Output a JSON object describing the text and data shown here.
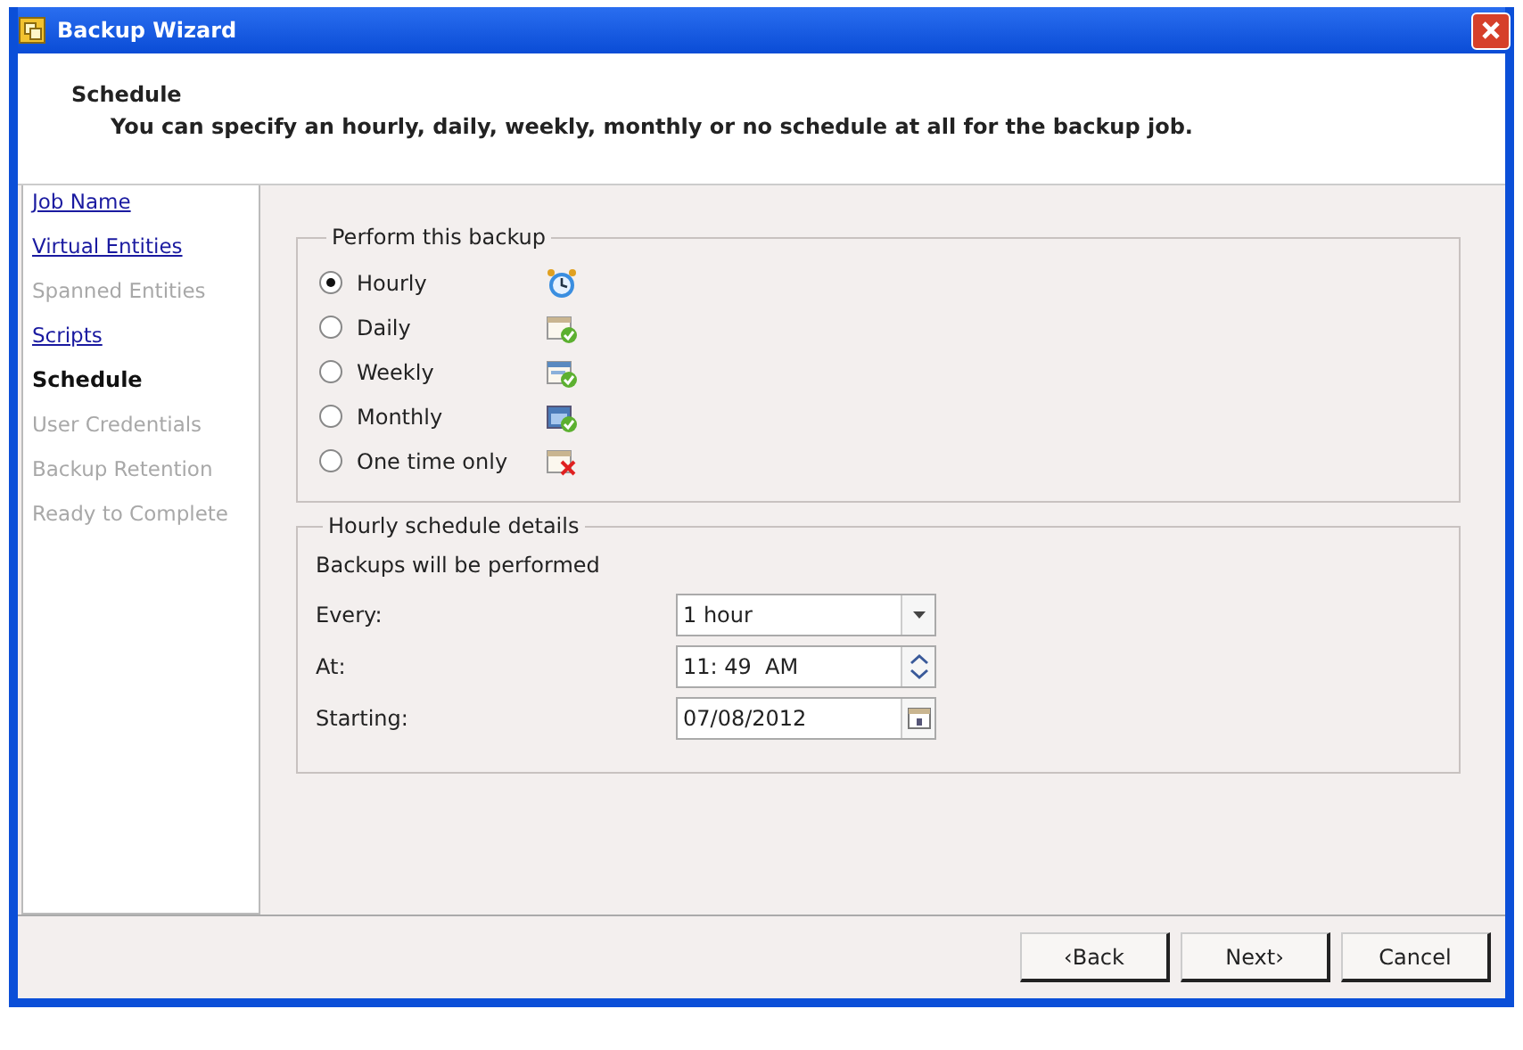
{
  "window": {
    "title": "Backup Wizard"
  },
  "header": {
    "title": "Schedule",
    "description": "You can specify an hourly, daily, weekly, monthly or no schedule at all for the backup job."
  },
  "steps": [
    {
      "label": "Job Name",
      "kind": "link"
    },
    {
      "label": "Virtual Entities",
      "kind": "link"
    },
    {
      "label": "Spanned Entities",
      "kind": "disabled"
    },
    {
      "label": "Scripts",
      "kind": "link"
    },
    {
      "label": "Schedule",
      "kind": "current"
    },
    {
      "label": "User Credentials",
      "kind": "disabled"
    },
    {
      "label": "Backup Retention",
      "kind": "disabled"
    },
    {
      "label": "Ready to Complete",
      "kind": "disabled"
    }
  ],
  "frequency": {
    "legend": "Perform this backup",
    "options": [
      {
        "label": "Hourly",
        "selected": true
      },
      {
        "label": "Daily",
        "selected": false
      },
      {
        "label": "Weekly",
        "selected": false
      },
      {
        "label": "Monthly",
        "selected": false
      },
      {
        "label": "One time only",
        "selected": false
      }
    ]
  },
  "details": {
    "legend": "Hourly schedule details",
    "intro": "Backups will be performed",
    "fields": [
      {
        "label": "Every:",
        "value": "1 hour",
        "kind": "dropdown"
      },
      {
        "label": "At:",
        "value": "11: 49  AM",
        "kind": "spinner"
      },
      {
        "label": "Starting:",
        "value": "07/08/2012",
        "kind": "date"
      }
    ]
  },
  "buttons": [
    "‹Back",
    "Next›",
    "Cancel"
  ]
}
